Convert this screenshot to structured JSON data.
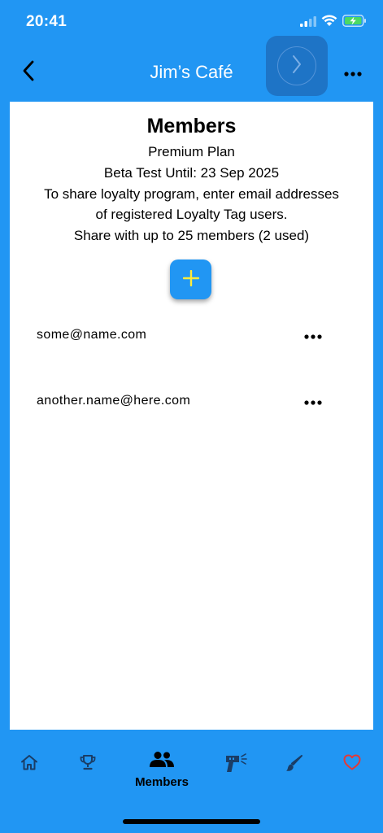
{
  "status_bar": {
    "time": "20:41"
  },
  "nav": {
    "title": "Jim’s Café",
    "back_icon": "chevron-left-icon",
    "forward_icon": "chevron-right-icon",
    "more_icon": "more-horizontal-icon"
  },
  "members": {
    "title": "Members",
    "plan": "Premium Plan",
    "beta": "Beta Test Until: 23 Sep 2025",
    "instructions_line1": "To share loyalty program, enter email addresses",
    "instructions_line2": "of registered Loyalty Tag users.",
    "limit": "Share with up to 25 members (2 used)",
    "add_icon": "plus-icon",
    "list": [
      {
        "email": "some@name.com"
      },
      {
        "email": "another.name@here.com"
      }
    ]
  },
  "tabs": [
    {
      "name": "home",
      "icon": "home-icon",
      "label": ""
    },
    {
      "name": "rewards",
      "icon": "trophy-icon",
      "label": ""
    },
    {
      "name": "members",
      "icon": "people-icon",
      "label": "Members",
      "active": true
    },
    {
      "name": "scan",
      "icon": "scanner-icon",
      "label": ""
    },
    {
      "name": "design",
      "icon": "brush-icon",
      "label": ""
    },
    {
      "name": "favorites",
      "icon": "heart-icon",
      "label": ""
    }
  ],
  "colors": {
    "primary": "#2196f3",
    "accent_plus": "#ffeb3b",
    "heart": "#e53935",
    "icon_dark": "#1a3d66"
  }
}
